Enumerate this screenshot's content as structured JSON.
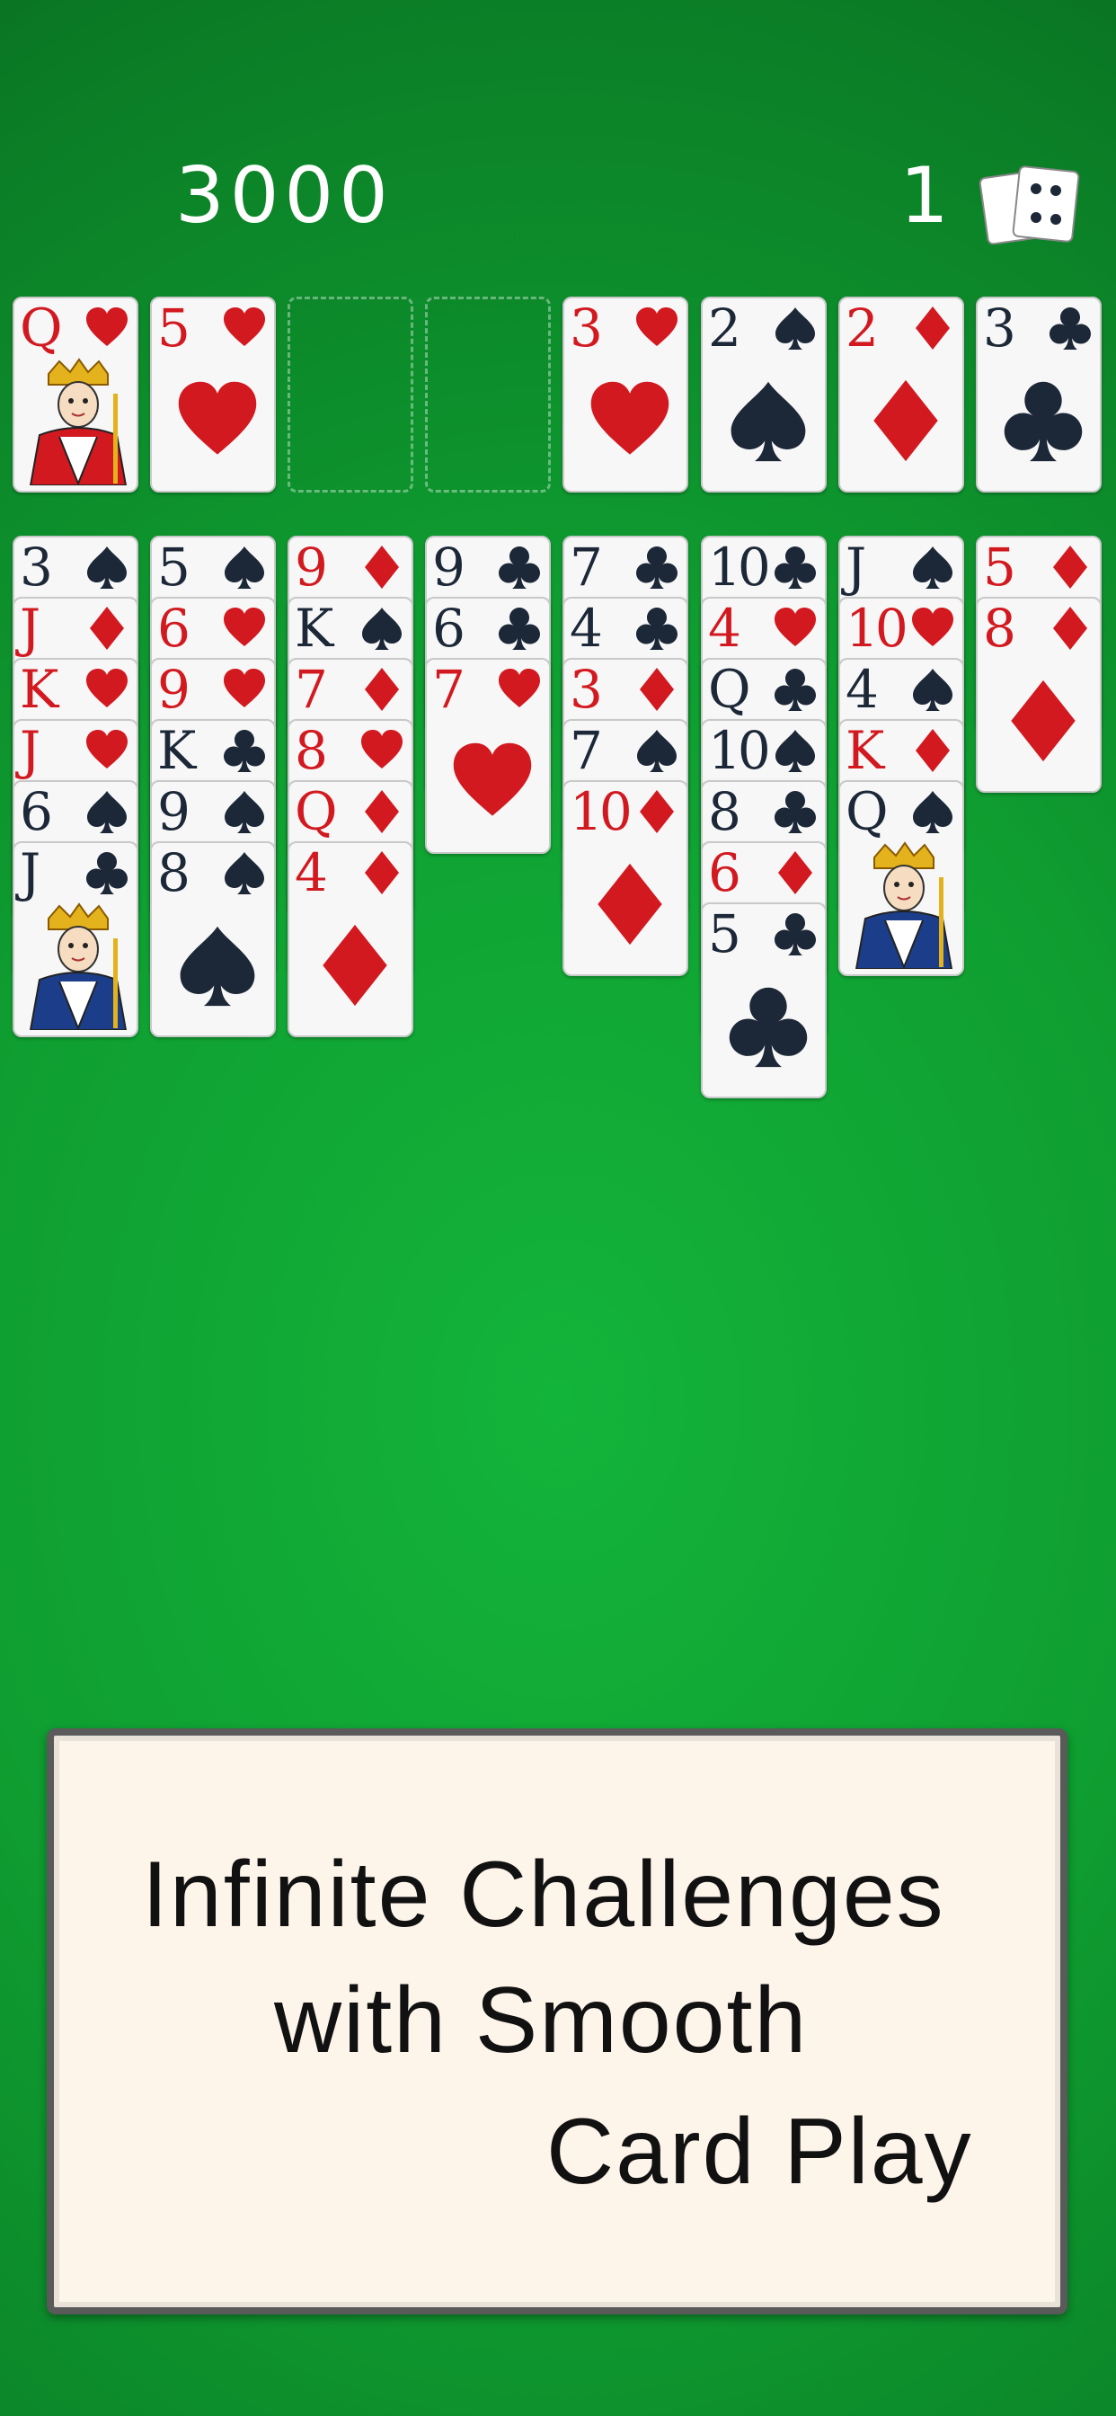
{
  "hud": {
    "score": "3000",
    "deals_left": "1"
  },
  "top_row": [
    {
      "rank": "Q",
      "suit": "hearts",
      "color": "red",
      "face": true
    },
    {
      "rank": "5",
      "suit": "hearts",
      "color": "red"
    },
    {
      "empty": true
    },
    {
      "empty": true
    },
    {
      "rank": "3",
      "suit": "hearts",
      "color": "red"
    },
    {
      "rank": "2",
      "suit": "spades",
      "color": "black"
    },
    {
      "rank": "2",
      "suit": "diamonds",
      "color": "red"
    },
    {
      "rank": "3",
      "suit": "clubs",
      "color": "black"
    }
  ],
  "tableau": [
    [
      [
        "3",
        "spades"
      ],
      [
        "J",
        "diamonds"
      ],
      [
        "K",
        "hearts"
      ],
      [
        "J",
        "hearts"
      ],
      [
        "6",
        "spades"
      ],
      [
        "J",
        "clubs",
        "face"
      ]
    ],
    [
      [
        "5",
        "spades"
      ],
      [
        "6",
        "hearts"
      ],
      [
        "9",
        "hearts"
      ],
      [
        "K",
        "clubs"
      ],
      [
        "9",
        "spades"
      ],
      [
        "8",
        "spades"
      ]
    ],
    [
      [
        "9",
        "diamonds"
      ],
      [
        "K",
        "spades"
      ],
      [
        "7",
        "diamonds"
      ],
      [
        "8",
        "hearts"
      ],
      [
        "Q",
        "diamonds"
      ],
      [
        "4",
        "diamonds"
      ]
    ],
    [
      [
        "9",
        "clubs"
      ],
      [
        "6",
        "clubs"
      ],
      [
        "7",
        "hearts"
      ]
    ],
    [
      [
        "7",
        "clubs"
      ],
      [
        "4",
        "clubs"
      ],
      [
        "3",
        "diamonds"
      ],
      [
        "7",
        "spades"
      ],
      [
        "10",
        "diamonds"
      ]
    ],
    [
      [
        "10",
        "clubs"
      ],
      [
        "4",
        "hearts"
      ],
      [
        "Q",
        "clubs"
      ],
      [
        "10",
        "spades"
      ],
      [
        "8",
        "clubs"
      ],
      [
        "6",
        "diamonds"
      ],
      [
        "5",
        "clubs"
      ]
    ],
    [
      [
        "J",
        "spades"
      ],
      [
        "10",
        "hearts"
      ],
      [
        "4",
        "spades"
      ],
      [
        "K",
        "diamonds"
      ],
      [
        "Q",
        "spades",
        "face"
      ]
    ],
    [
      [
        "5",
        "diamonds"
      ],
      [
        "8",
        "diamonds"
      ]
    ]
  ],
  "banner": {
    "line1": "Infinite Challenges",
    "line2": "with Smooth",
    "line3": "Card Play"
  },
  "colors": {
    "red": "#d21920",
    "black": "#1c2838",
    "felt": "#13b43a"
  }
}
